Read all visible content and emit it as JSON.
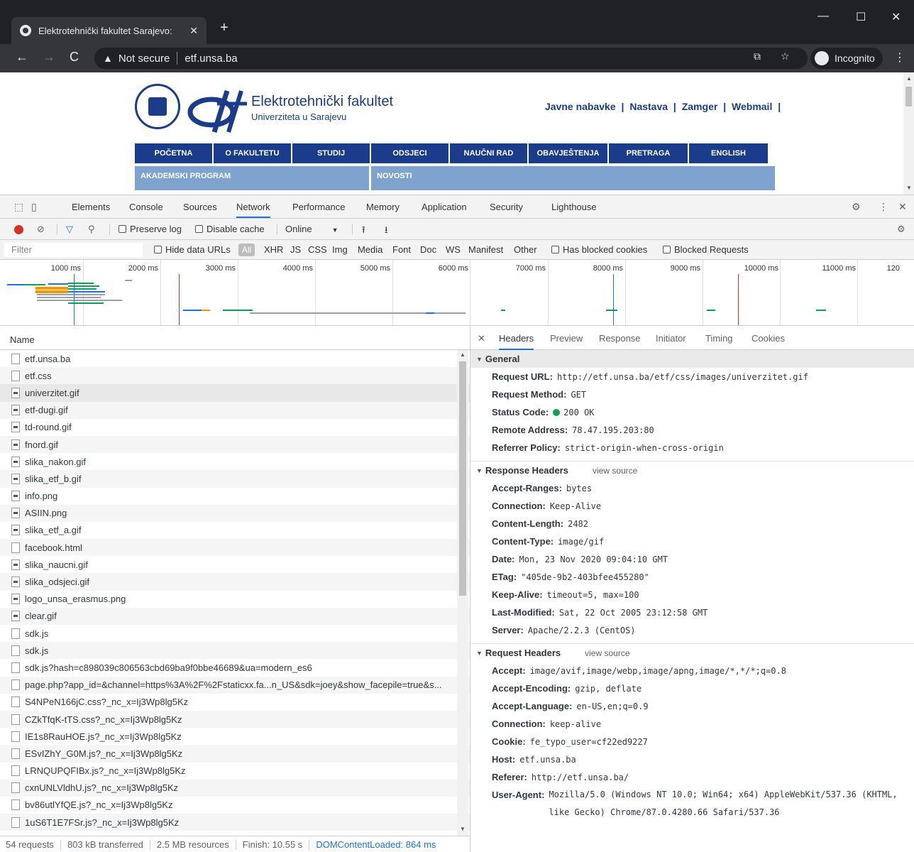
{
  "browser": {
    "tab_title": "Elektrotehnički fakultet Sarajevo:",
    "security_label": "Not secure",
    "url": "etf.unsa.ba",
    "incognito_label": "Incognito"
  },
  "page": {
    "faculty_name": "Elektrotehnički fakultet",
    "faculty_sub": "Univerziteta u Sarajevu",
    "top_links": [
      "Javne nabavke",
      "|",
      "Nastava",
      "|",
      "Zamger",
      "|",
      "Webmail",
      "|"
    ],
    "menu": [
      "POČETNA",
      "O FAKULTETU",
      "STUDIJ",
      "ODSJECI",
      "NAUČNI RAD",
      "OBAVJEŠTENJA",
      "PRETRAGA",
      "ENGLISH"
    ],
    "sub_left": "AKADEMSKI PROGRAM",
    "sub_right": "NOVOSTI"
  },
  "devtools": {
    "tabs": [
      "Elements",
      "Console",
      "Sources",
      "Network",
      "Performance",
      "Memory",
      "Application",
      "Security",
      "Lighthouse"
    ],
    "active_tab": "Network",
    "toolbar": {
      "preserve_log": "Preserve log",
      "disable_cache": "Disable cache",
      "throttle": "Online"
    },
    "filter": {
      "placeholder": "Filter",
      "hide_data_urls": "Hide data URLs",
      "all": "All",
      "types": [
        "XHR",
        "JS",
        "CSS",
        "Img",
        "Media",
        "Font",
        "Doc",
        "WS",
        "Manifest",
        "Other"
      ],
      "has_blocked_cookies": "Has blocked cookies",
      "blocked_requests": "Blocked Requests"
    },
    "overview_ticks": [
      "1000 ms",
      "2000 ms",
      "3000 ms",
      "4000 ms",
      "5000 ms",
      "6000 ms",
      "7000 ms",
      "8000 ms",
      "9000 ms",
      "10000 ms",
      "11000 ms",
      "120"
    ],
    "list_header": "Name",
    "requests": [
      "etf.unsa.ba",
      "etf.css",
      "univerzitet.gif",
      "etf-dugi.gif",
      "td-round.gif",
      "fnord.gif",
      "slika_nakon.gif",
      "slika_etf_b.gif",
      "info.png",
      "ASIIN.png",
      "slika_etf_a.gif",
      "facebook.html",
      "slika_naucni.gif",
      "slika_odsjeci.gif",
      "logo_unsa_erasmus.png",
      "clear.gif",
      "sdk.js",
      "sdk.js",
      "sdk.js?hash=c898039c806563cbd69ba9f0bbe46689&ua=modern_es6",
      "page.php?app_id=&channel=https%3A%2F%2Fstaticxx.fa...n_US&sdk=joey&show_facepile=true&s...",
      "S4NPeN166jC.css?_nc_x=Ij3Wp8lg5Kz",
      "CZkTfqK-tTS.css?_nc_x=Ij3Wp8lg5Kz",
      "IE1s8RauHOE.js?_nc_x=Ij3Wp8lg5Kz",
      "ESvIZhY_G0M.js?_nc_x=Ij3Wp8lg5Kz",
      "LRNQUPQFIBx.js?_nc_x=Ij3Wp8lg5Kz",
      "cxnUNLVldhU.js?_nc_x=Ij3Wp8lg5Kz",
      "bv86utlYfQE.js?_nc_x=Ij3Wp8lg5Kz",
      "1uS6T1E7FSr.js?_nc_x=Ij3Wp8lg5Kz"
    ],
    "selected_request": "univerzitet.gif",
    "status": {
      "requests": "54 requests",
      "transferred": "803 kB transferred",
      "resources": "2.5 MB resources",
      "finish": "Finish: 10.55 s",
      "dom": "DOMContentLoaded: 864 ms"
    },
    "detail_tabs": [
      "Headers",
      "Preview",
      "Response",
      "Initiator",
      "Timing",
      "Cookies"
    ],
    "detail_active": "Headers",
    "general": {
      "title": "General",
      "rows": [
        {
          "k": "Request URL:",
          "v": "http://etf.unsa.ba/etf/css/images/univerzitet.gif"
        },
        {
          "k": "Request Method:",
          "v": "GET"
        },
        {
          "k": "Status Code:",
          "v": "200 OK"
        },
        {
          "k": "Remote Address:",
          "v": "78.47.195.203:80"
        },
        {
          "k": "Referrer Policy:",
          "v": "strict-origin-when-cross-origin"
        }
      ]
    },
    "response_headers": {
      "title": "Response Headers",
      "view_source": "view source",
      "rows": [
        {
          "k": "Accept-Ranges:",
          "v": "bytes"
        },
        {
          "k": "Connection:",
          "v": "Keep-Alive"
        },
        {
          "k": "Content-Length:",
          "v": "2482"
        },
        {
          "k": "Content-Type:",
          "v": "image/gif"
        },
        {
          "k": "Date:",
          "v": "Mon, 23 Nov 2020 09:04:10 GMT"
        },
        {
          "k": "ETag:",
          "v": "\"405de-9b2-403bfee455280\""
        },
        {
          "k": "Keep-Alive:",
          "v": "timeout=5, max=100"
        },
        {
          "k": "Last-Modified:",
          "v": "Sat, 22 Oct 2005 23:12:58 GMT"
        },
        {
          "k": "Server:",
          "v": "Apache/2.2.3 (CentOS)"
        }
      ]
    },
    "request_headers": {
      "title": "Request Headers",
      "view_source": "view source",
      "rows": [
        {
          "k": "Accept:",
          "v": "image/avif,image/webp,image/apng,image/*,*/*;q=0.8"
        },
        {
          "k": "Accept-Encoding:",
          "v": "gzip, deflate"
        },
        {
          "k": "Accept-Language:",
          "v": "en-US,en;q=0.9"
        },
        {
          "k": "Connection:",
          "v": "keep-alive"
        },
        {
          "k": "Cookie:",
          "v": "fe_typo_user=cf22ed9227"
        },
        {
          "k": "Host:",
          "v": "etf.unsa.ba"
        },
        {
          "k": "Referer:",
          "v": "http://etf.unsa.ba/"
        },
        {
          "k": "User-Agent:",
          "v": "Mozilla/5.0 (Windows NT 10.0; Win64; x64) AppleWebKit/537.36 (KHTML, like Gecko) Chrome/87.0.4280.66 Safari/537.36"
        }
      ]
    }
  },
  "colors": {
    "accent": "#1a73e8",
    "brand": "#1a3c8a",
    "record": "#d93025",
    "status_ok": "#0f9d58"
  }
}
